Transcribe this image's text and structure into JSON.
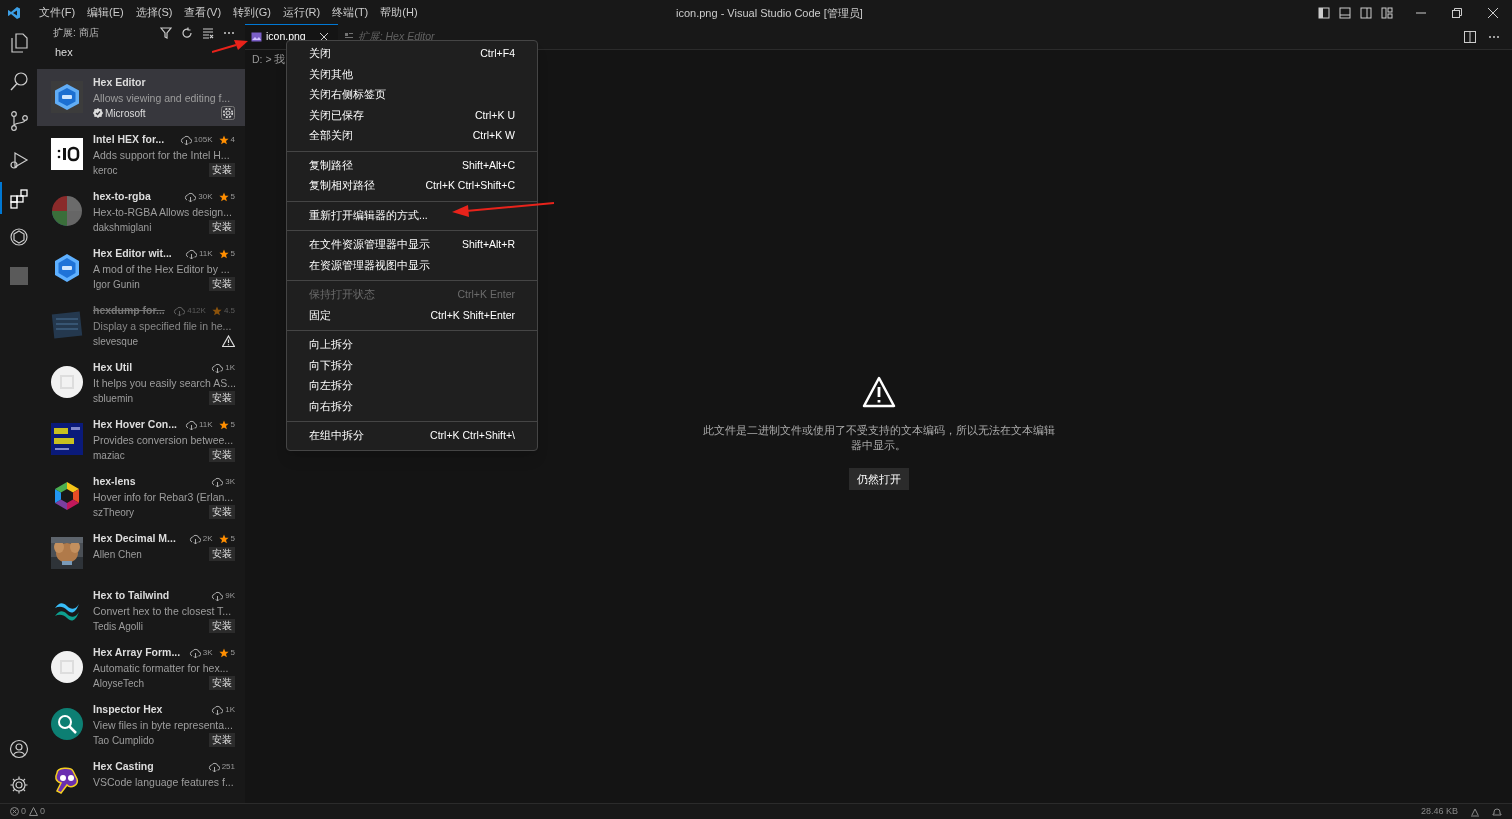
{
  "menu_bar": [
    "文件(F)",
    "编辑(E)",
    "选择(S)",
    "查看(V)",
    "转到(G)",
    "运行(R)",
    "终端(T)",
    "帮助(H)"
  ],
  "window": {
    "title": "icon.png - Visual Studio Code [管理员]"
  },
  "sidebar": {
    "title": "扩展: 商店",
    "search": {
      "value": "hex"
    },
    "extensions": [
      {
        "name": "Hex Editor",
        "description": "Allows viewing and editing f...",
        "publisher": "Microsoft",
        "verified": true,
        "selected": true,
        "deprecated": false,
        "installed": true
      },
      {
        "name": "Intel HEX for...",
        "downloads": "105K",
        "rating": "4",
        "description": "Adds support for the Intel H...",
        "publisher": "keroc",
        "install": "安装",
        "selected": false,
        "deprecated": false
      },
      {
        "name": "hex-to-rgba",
        "downloads": "30K",
        "rating": "5",
        "description": "Hex-to-RGBA Allows design...",
        "publisher": "dakshmiglani",
        "install": "安装",
        "selected": false,
        "deprecated": false
      },
      {
        "name": "Hex Editor wit...",
        "downloads": "11K",
        "rating": "5",
        "description": "A mod of the Hex Editor by ...",
        "publisher": "Igor Gunin",
        "install": "安装",
        "selected": false,
        "deprecated": false
      },
      {
        "name": "hexdump for...",
        "downloads": "412K",
        "rating": "4.5",
        "description": "Display a specified file in he...",
        "publisher": "slevesque",
        "selected": false,
        "deprecated": true
      },
      {
        "name": "Hex Util",
        "downloads": "1K",
        "description": "It helps you easily search AS...",
        "publisher": "sbluemin",
        "install": "安装",
        "selected": false,
        "deprecated": false
      },
      {
        "name": "Hex Hover Con...",
        "downloads": "11K",
        "rating": "5",
        "description": "Provides conversion betwee...",
        "publisher": "maziac",
        "install": "安装",
        "selected": false,
        "deprecated": false
      },
      {
        "name": "hex-lens",
        "downloads": "3K",
        "description": "Hover info for Rebar3 (Erlan...",
        "publisher": "szTheory",
        "install": "安装",
        "selected": false,
        "deprecated": false
      },
      {
        "name": "Hex Decimal M...",
        "downloads": "2K",
        "rating": "5",
        "publisher": "Allen Chen",
        "install": "安装",
        "selected": false,
        "deprecated": false
      },
      {
        "name": "Hex to Tailwind",
        "downloads": "9K",
        "description": "Convert hex to the closest T...",
        "publisher": "Tedis Agolli",
        "install": "安装",
        "selected": false,
        "deprecated": false
      },
      {
        "name": "Hex Array Form...",
        "downloads": "3K",
        "rating": "5",
        "description": "Automatic formatter for hex...",
        "publisher": "AloyseTech",
        "install": "安装",
        "selected": false,
        "deprecated": false
      },
      {
        "name": "Inspector Hex",
        "downloads": "1K",
        "description": "View files in byte representa...",
        "publisher": "Tao Cumplido",
        "install": "安装",
        "selected": false,
        "deprecated": false
      },
      {
        "name": "Hex Casting",
        "downloads": "251",
        "description": "VSCode language features f...",
        "selected": false,
        "deprecated": false
      }
    ]
  },
  "tabs": [
    {
      "label": "icon.png",
      "selected": true
    },
    {
      "label": "扩展: Hex Editor",
      "selected": false
    }
  ],
  "breadcrumb": "D: > 我",
  "context_menu": [
    [
      {
        "label": "关闭",
        "shortcut": "Ctrl+F4",
        "disabled": false
      },
      {
        "label": "关闭其他",
        "disabled": false
      },
      {
        "label": "关闭右侧标签页",
        "disabled": false
      },
      {
        "label": "关闭已保存",
        "shortcut": "Ctrl+K U",
        "disabled": false
      },
      {
        "label": "全部关闭",
        "shortcut": "Ctrl+K W",
        "disabled": false
      }
    ],
    [
      {
        "label": "复制路径",
        "shortcut": "Shift+Alt+C",
        "disabled": false
      },
      {
        "label": "复制相对路径",
        "shortcut": "Ctrl+K Ctrl+Shift+C",
        "disabled": false
      }
    ],
    [
      {
        "label": "重新打开编辑器的方式...",
        "disabled": false
      }
    ],
    [
      {
        "label": "在文件资源管理器中显示",
        "shortcut": "Shift+Alt+R",
        "disabled": false
      },
      {
        "label": "在资源管理器视图中显示",
        "disabled": false
      }
    ],
    [
      {
        "label": "保持打开状态",
        "shortcut": "Ctrl+K Enter",
        "disabled": true
      },
      {
        "label": "固定",
        "shortcut": "Ctrl+K Shift+Enter",
        "disabled": false
      }
    ],
    [
      {
        "label": "向上拆分",
        "disabled": false
      },
      {
        "label": "向下拆分",
        "disabled": false
      },
      {
        "label": "向左拆分",
        "disabled": false
      },
      {
        "label": "向右拆分",
        "disabled": false
      }
    ],
    [
      {
        "label": "在组中拆分",
        "shortcut": "Ctrl+K Ctrl+Shift+\\",
        "disabled": false
      }
    ]
  ],
  "editor": {
    "message": "此文件是二进制文件或使用了不受支持的文本编码，所以无法在文本编辑器中显示。",
    "button": "仍然打开"
  },
  "status_bar": {
    "errors": "0",
    "warnings": "0",
    "file_size": "28.46 KB"
  }
}
